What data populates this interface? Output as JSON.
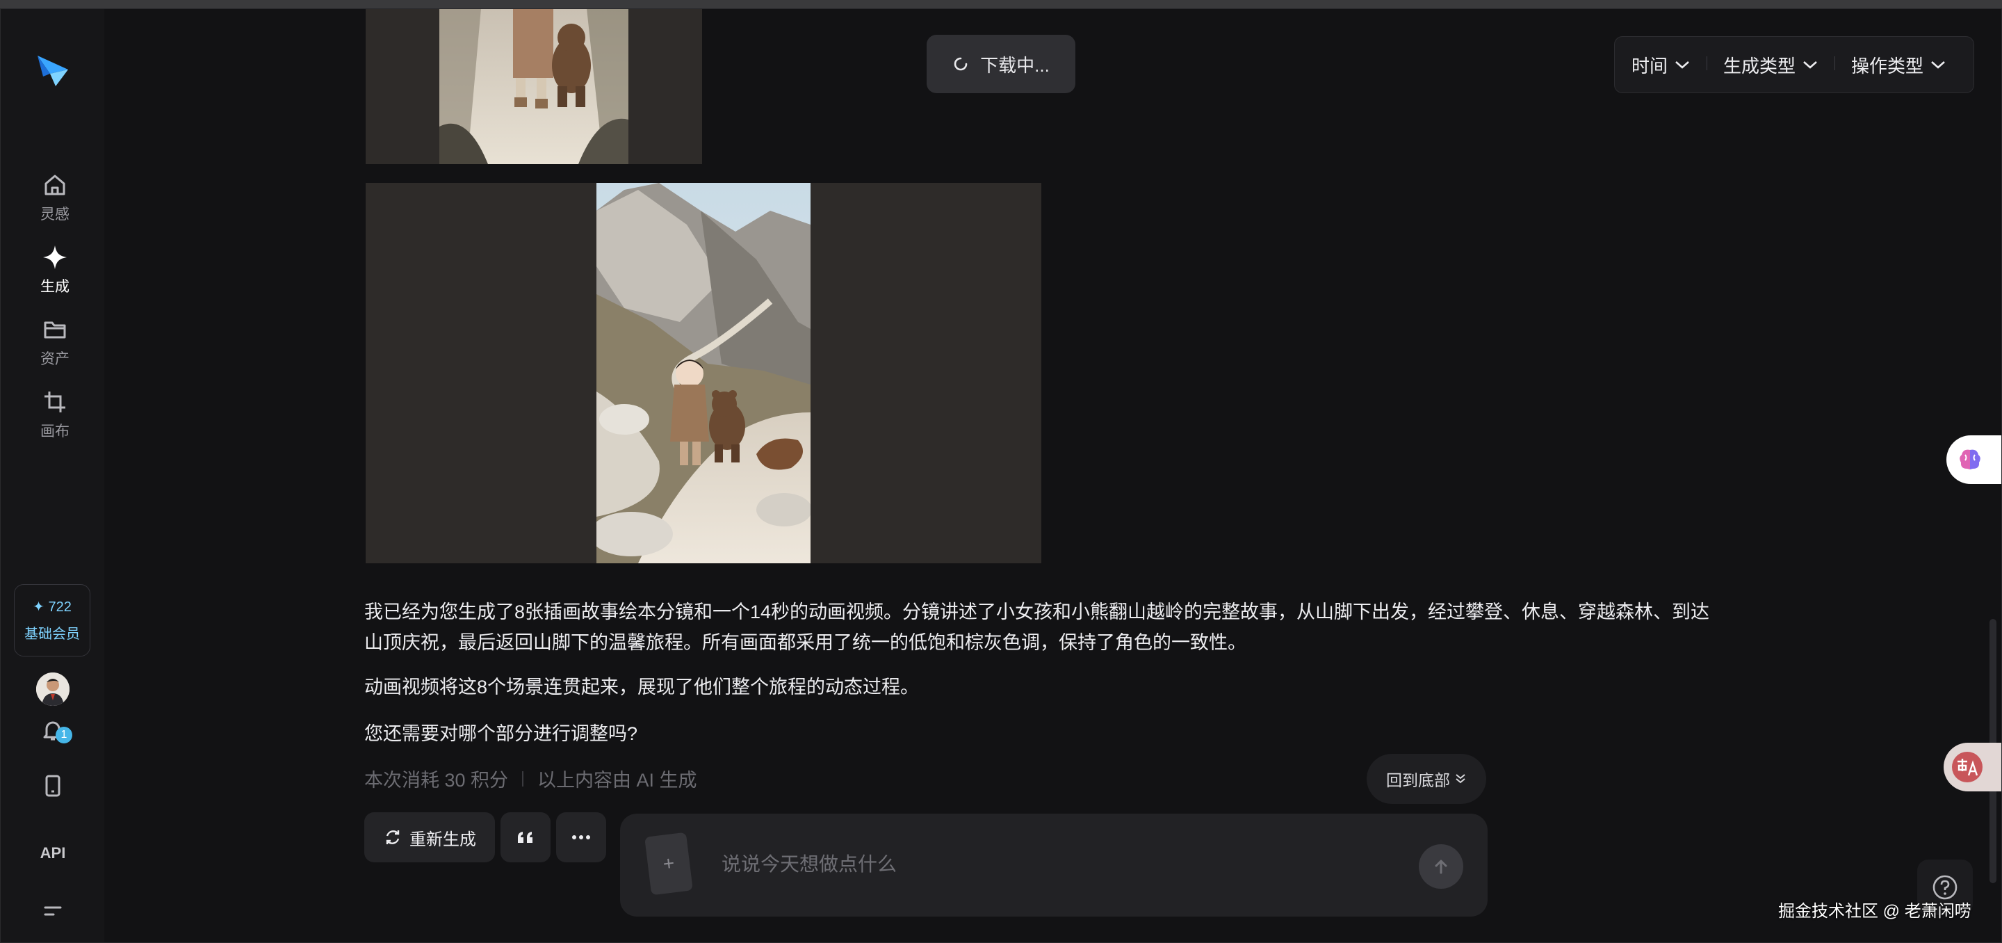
{
  "sidebar": {
    "nav": [
      {
        "label": "灵感",
        "icon": "home-icon"
      },
      {
        "label": "生成",
        "icon": "sparkle-icon"
      },
      {
        "label": "资产",
        "icon": "folder-icon"
      },
      {
        "label": "画布",
        "icon": "canvas-crop-icon"
      }
    ],
    "credits": {
      "value": "✦ 722",
      "tier": "基础会员"
    },
    "notification_count": "1",
    "api_label": "API"
  },
  "toast": {
    "text": "下载中..."
  },
  "filters": [
    {
      "label": "时间"
    },
    {
      "label": "生成类型"
    },
    {
      "label": "操作类型"
    }
  ],
  "message": {
    "paragraph1": "我已经为您生成了8张插画故事绘本分镜和一个14秒的动画视频。分镜讲述了小女孩和小熊翻山越岭的完整故事，从山脚下出发，经过攀登、休息、穿越森林、到达山顶庆祝，最后返回山脚下的温馨旅程。所有画面都采用了统一的低饱和棕灰色调，保持了角色的一致性。",
    "paragraph2": "动画视频将这8个场景连贯起来，展现了他们整个旅程的动态过程。",
    "paragraph3": "您还需要对哪个部分进行调整吗?",
    "cost": "本次消耗 30 积分",
    "ai_note": "以上内容由 AI 生成"
  },
  "actions": {
    "regenerate": "重新生成",
    "quote_icon": "quote-icon",
    "more_icon": "more-icon",
    "back_to_bottom": "回到底部"
  },
  "composer": {
    "placeholder": "说说今天想做点什么",
    "attach_symbol": "+"
  },
  "watermark": "掘金技术社区 @ 老萧闲唠",
  "colors": {
    "background": "#121214",
    "sidebar": "#161618",
    "accent": "#7fd3ff",
    "badge": "#46b6e8"
  }
}
